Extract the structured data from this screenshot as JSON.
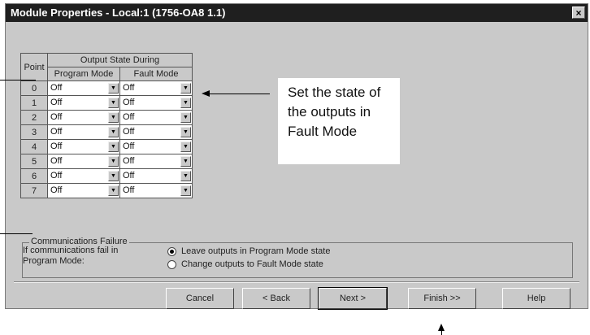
{
  "dialog": {
    "title": "Module Properties - Local:1 (1756-OA8 1.1)",
    "close_glyph": "×"
  },
  "grid": {
    "header_point": "Point",
    "header_group": "Output State During",
    "header_program": "Program Mode",
    "header_fault": "Fault Mode",
    "rows": [
      {
        "point": "0",
        "program": "Off",
        "fault": "Off"
      },
      {
        "point": "1",
        "program": "Off",
        "fault": "Off"
      },
      {
        "point": "2",
        "program": "Off",
        "fault": "Off"
      },
      {
        "point": "3",
        "program": "Off",
        "fault": "Off"
      },
      {
        "point": "4",
        "program": "Off",
        "fault": "Off"
      },
      {
        "point": "5",
        "program": "Off",
        "fault": "Off"
      },
      {
        "point": "6",
        "program": "Off",
        "fault": "Off"
      },
      {
        "point": "7",
        "program": "Off",
        "fault": "Off"
      }
    ]
  },
  "comms": {
    "group_label": "Communications Failure",
    "text_line1": "If communications fail in",
    "text_line2": "Program Mode:",
    "option1": "Leave outputs in Program Mode state",
    "option2": "Change outputs to Fault Mode state",
    "selected": "option1"
  },
  "buttons": {
    "cancel": "Cancel",
    "back": "< Back",
    "next": "Next >",
    "finish": "Finish >>",
    "help": "Help"
  },
  "callout": {
    "line1": "Set the state of",
    "line2": "the outputs in",
    "line3": "Fault Mode"
  }
}
